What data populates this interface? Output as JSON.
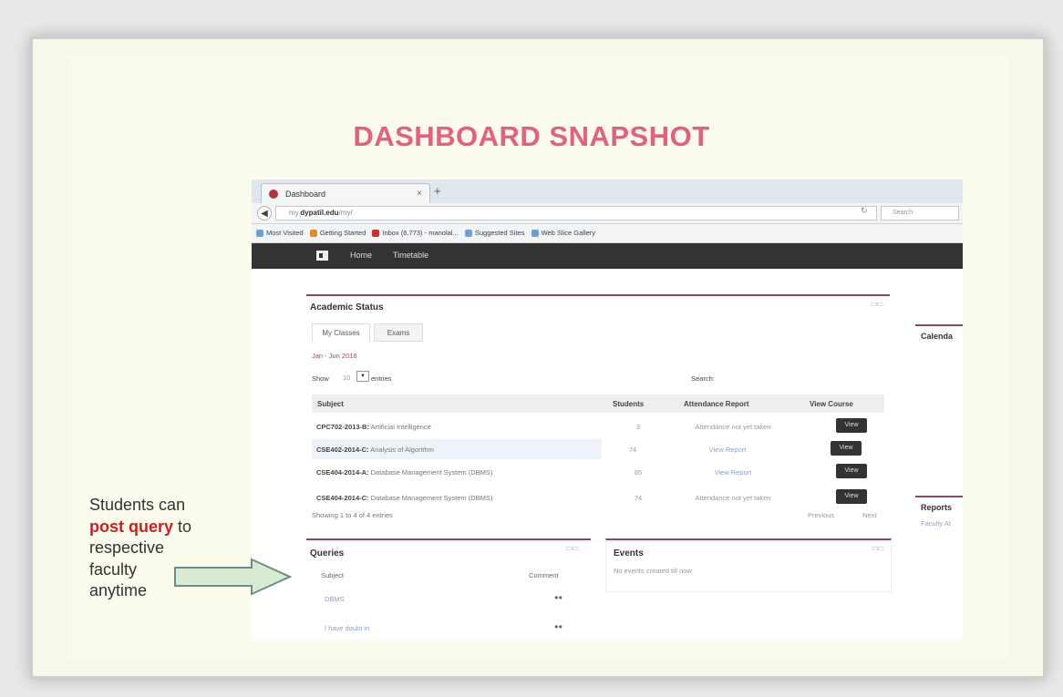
{
  "slide": {
    "title": "DASHBOARD SNAPSHOT",
    "caption": {
      "line1": "Students can",
      "highlight": "post query",
      "line2_suffix": " to",
      "line3": "respective",
      "line4": "faculty",
      "line5": "anytime"
    },
    "colors": {
      "title": "#e2617c",
      "highlight": "#c82020",
      "arrow_fill": "#d9ead3",
      "arrow_stroke": "#6b8e8a"
    }
  },
  "browser": {
    "tab_title": "Dashboard",
    "url_prefix": "my.",
    "url_domain": "dypatil.edu",
    "url_path": "/my/",
    "search_placeholder": "Search",
    "bookmarks": [
      {
        "label": "Most Visited",
        "color": "#6aa0d8"
      },
      {
        "label": "Getting Started",
        "color": "#e08a2a"
      },
      {
        "label": "Inbox (6,773) - manolal...",
        "color": "#d03030"
      },
      {
        "label": "Suggested Sites",
        "color": "#6aa0d8"
      },
      {
        "label": "Web Slice Gallery",
        "color": "#6aa0d8"
      }
    ]
  },
  "nav": {
    "home": "Home",
    "timetable": "Timetable"
  },
  "academic_status": {
    "title": "Academic Status",
    "tabs": [
      "My Classes",
      "Exams"
    ],
    "term": "Jan - Jun 2016",
    "show_label": "Show",
    "entries_value": "10",
    "entries_label": "entries",
    "search_label": "Search:",
    "columns": [
      "Subject",
      "Students",
      "Attendance Report",
      "View Course"
    ],
    "rows": [
      {
        "code": "CPC702-2013-B:",
        "name": " Artificial Intelligence",
        "students": "3",
        "attendance": "Attendance not yet taken",
        "view": "View"
      },
      {
        "code": "CSE402-2014-C:",
        "name": " Analysis of Algorithm",
        "students": "74",
        "attendance": "View Report",
        "view": "View"
      },
      {
        "code": "CSE404-2014-A:",
        "name": " Database Management System (DBMS)",
        "students": "85",
        "attendance": "View Report",
        "view": "View"
      },
      {
        "code": "CSE404-2014-C:",
        "name": " Database Management System (DBMS)",
        "students": "74",
        "attendance": "Attendance not yet taken",
        "view": "View"
      }
    ],
    "showing": "Showing 1 to 4 of 4 entries",
    "previous": "Previous",
    "next": "Next"
  },
  "queries": {
    "title": "Queries",
    "columns": [
      "Subject",
      "Comment"
    ],
    "rows": [
      {
        "subject": "DBMS"
      },
      {
        "subject": "I have doubt in"
      }
    ]
  },
  "events": {
    "title": "Events",
    "empty": "No events created till now"
  },
  "side": {
    "calendar": "Calenda",
    "reports": "Reports",
    "reports_sub": "Faculty At"
  }
}
